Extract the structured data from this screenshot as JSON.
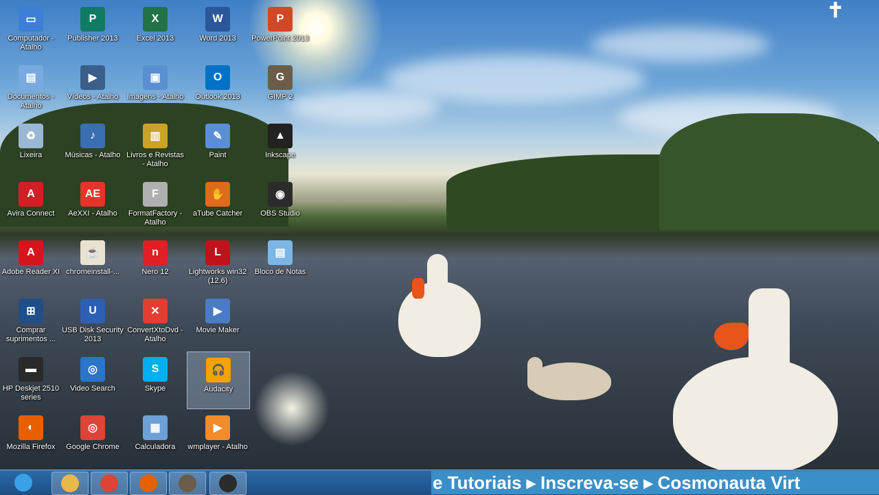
{
  "desktop_icons": [
    {
      "label": "Computador - Atalho",
      "icon": "computer-icon",
      "color": "#3d7fd6",
      "glyph": "▭"
    },
    {
      "label": "Publisher 2013",
      "icon": "publisher-icon",
      "color": "#117a65",
      "glyph": "P"
    },
    {
      "label": "Excel 2013",
      "icon": "excel-icon",
      "color": "#217346",
      "glyph": "X"
    },
    {
      "label": "Word 2013",
      "icon": "word-icon",
      "color": "#2b579a",
      "glyph": "W"
    },
    {
      "label": "PowerPoint 2013",
      "icon": "powerpoint-icon",
      "color": "#d24726",
      "glyph": "P"
    },
    {
      "label": "Documentos - Atalho",
      "icon": "documents-icon",
      "color": "#7aa9df",
      "glyph": "▤"
    },
    {
      "label": "Vídeos - Atalho",
      "icon": "videos-icon",
      "color": "#3a5f8a",
      "glyph": "▶"
    },
    {
      "label": "Imagens - Atalho",
      "icon": "images-icon",
      "color": "#5b8fd0",
      "glyph": "▣"
    },
    {
      "label": "Outlook 2013",
      "icon": "outlook-icon",
      "color": "#0072c6",
      "glyph": "O"
    },
    {
      "label": "GIMP 2",
      "icon": "gimp-icon",
      "color": "#6b5d4a",
      "glyph": "G"
    },
    {
      "label": "Lixeira",
      "icon": "recycle-bin-icon",
      "color": "#9ab7d6",
      "glyph": "♻"
    },
    {
      "label": "Músicas - Atalho",
      "icon": "music-icon",
      "color": "#3b6fb0",
      "glyph": "♪"
    },
    {
      "label": "Livros e Revistas - Atalho",
      "icon": "books-icon",
      "color": "#c9a227",
      "glyph": "▥"
    },
    {
      "label": "Paint",
      "icon": "paint-icon",
      "color": "#5a8fd8",
      "glyph": "✎"
    },
    {
      "label": "Inkscape",
      "icon": "inkscape-icon",
      "color": "#222222",
      "glyph": "▲"
    },
    {
      "label": "Avira Connect",
      "icon": "avira-icon",
      "color": "#d11f26",
      "glyph": "A"
    },
    {
      "label": "AeXXI - Atalho",
      "icon": "aexxi-icon",
      "color": "#e5342a",
      "glyph": "AE"
    },
    {
      "label": "FormatFactory - Atalho",
      "icon": "formatfactory-icon",
      "color": "#b0b0b0",
      "glyph": "F"
    },
    {
      "label": "aTube Catcher",
      "icon": "atube-catcher-icon",
      "color": "#e06a1b",
      "glyph": "✋"
    },
    {
      "label": "OBS Studio",
      "icon": "obs-icon",
      "color": "#2b2b2b",
      "glyph": "◉"
    },
    {
      "label": "Adobe Reader XI",
      "icon": "adobe-reader-icon",
      "color": "#d4151c",
      "glyph": "A"
    },
    {
      "label": "chromeinstall-...",
      "icon": "java-installer-icon",
      "color": "#e8e2d0",
      "glyph": "☕"
    },
    {
      "label": "Nero 12",
      "icon": "nero-icon",
      "color": "#e21e26",
      "glyph": "n"
    },
    {
      "label": "Lightworks win32 (12.6)",
      "icon": "lightworks-icon",
      "color": "#c1121c",
      "glyph": "L"
    },
    {
      "label": "Bloco de Notas",
      "icon": "notepad-icon",
      "color": "#7bb6e6",
      "glyph": "▤"
    },
    {
      "label": "Comprar suprimentos ...",
      "icon": "shopping-icon",
      "color": "#1f4e8a",
      "glyph": "⊞"
    },
    {
      "label": "USB Disk Security 2013",
      "icon": "usb-disk-security-icon",
      "color": "#2d5fb5",
      "glyph": "U"
    },
    {
      "label": "ConvertXtoDvd - Atalho",
      "icon": "convertxtodvd-icon",
      "color": "#e53d2f",
      "glyph": "✕"
    },
    {
      "label": "Movie Maker",
      "icon": "movie-maker-icon",
      "color": "#4a7cc4",
      "glyph": "▶"
    },
    {
      "label": "HP Deskjet 2510 series",
      "icon": "printer-icon",
      "color": "#2a2a2a",
      "glyph": "▬"
    },
    {
      "label": "Video Search",
      "icon": "video-search-icon",
      "color": "#2a74c9",
      "glyph": "◎"
    },
    {
      "label": "Skype",
      "icon": "skype-icon",
      "color": "#00aff0",
      "glyph": "S"
    },
    {
      "label": "Audacity",
      "icon": "audacity-icon",
      "color": "#f2a300",
      "glyph": "🎧"
    },
    {
      "label": "Mozilla Firefox",
      "icon": "firefox-icon",
      "color": "#e66000",
      "glyph": "◐"
    },
    {
      "label": "Google Chrome",
      "icon": "chrome-icon",
      "color": "#db4437",
      "glyph": "◎"
    },
    {
      "label": "Calculadora",
      "icon": "calculator-icon",
      "color": "#6ea0d8",
      "glyph": "▦"
    },
    {
      "label": "wmplayer - Atalho",
      "icon": "wmplayer-icon",
      "color": "#f28c28",
      "glyph": "▶"
    }
  ],
  "taskbar": {
    "items": [
      {
        "icon": "start-orb-icon",
        "color": "#3aa0e8"
      },
      {
        "icon": "file-explorer-icon",
        "color": "#e8b84a"
      },
      {
        "icon": "chrome-icon",
        "color": "#db4437"
      },
      {
        "icon": "firefox-icon",
        "color": "#e66000"
      },
      {
        "icon": "gimp-icon",
        "color": "#6b5d4a"
      },
      {
        "icon": "obs-icon",
        "color": "#2b2b2b"
      }
    ]
  },
  "ticker": {
    "text": "e Tutoriais ▸ Inscreva-se ▸ Cosmonauta Virt"
  },
  "overlay": {
    "cross": "✝"
  }
}
